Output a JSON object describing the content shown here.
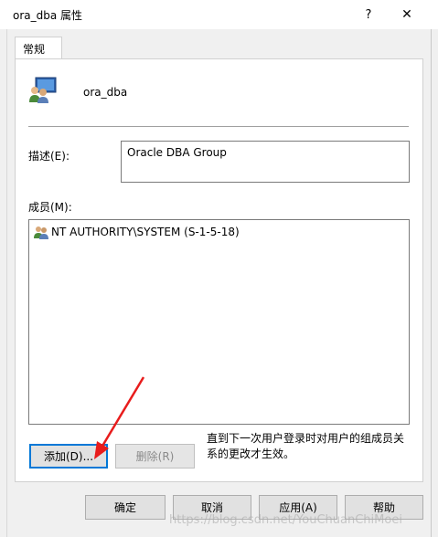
{
  "window": {
    "title": "ora_dba 属性",
    "help_glyph": "?",
    "close_glyph": "✕"
  },
  "tabs": [
    {
      "label": "常规"
    }
  ],
  "general": {
    "group_name": "ora_dba",
    "description_label": "描述(E):",
    "description_value": "Oracle DBA Group",
    "members_label": "成员(M):",
    "members": [
      {
        "name": "NT AUTHORITY\\SYSTEM (S-1-5-18)",
        "icon": "user-group-icon"
      }
    ],
    "add_button": "添加(D)...",
    "remove_button": "删除(R)",
    "note": "直到下一次用户登录时对用户的组成员关系的更改才生效。"
  },
  "footer": {
    "ok": "确定",
    "cancel": "取消",
    "apply": "应用(A)",
    "help": "帮助"
  },
  "watermark": "https://blog.csdn.net/YouChuanChiMoei",
  "colors": {
    "annotation_arrow": "#e81c1c",
    "focus_border": "#0078d7"
  }
}
